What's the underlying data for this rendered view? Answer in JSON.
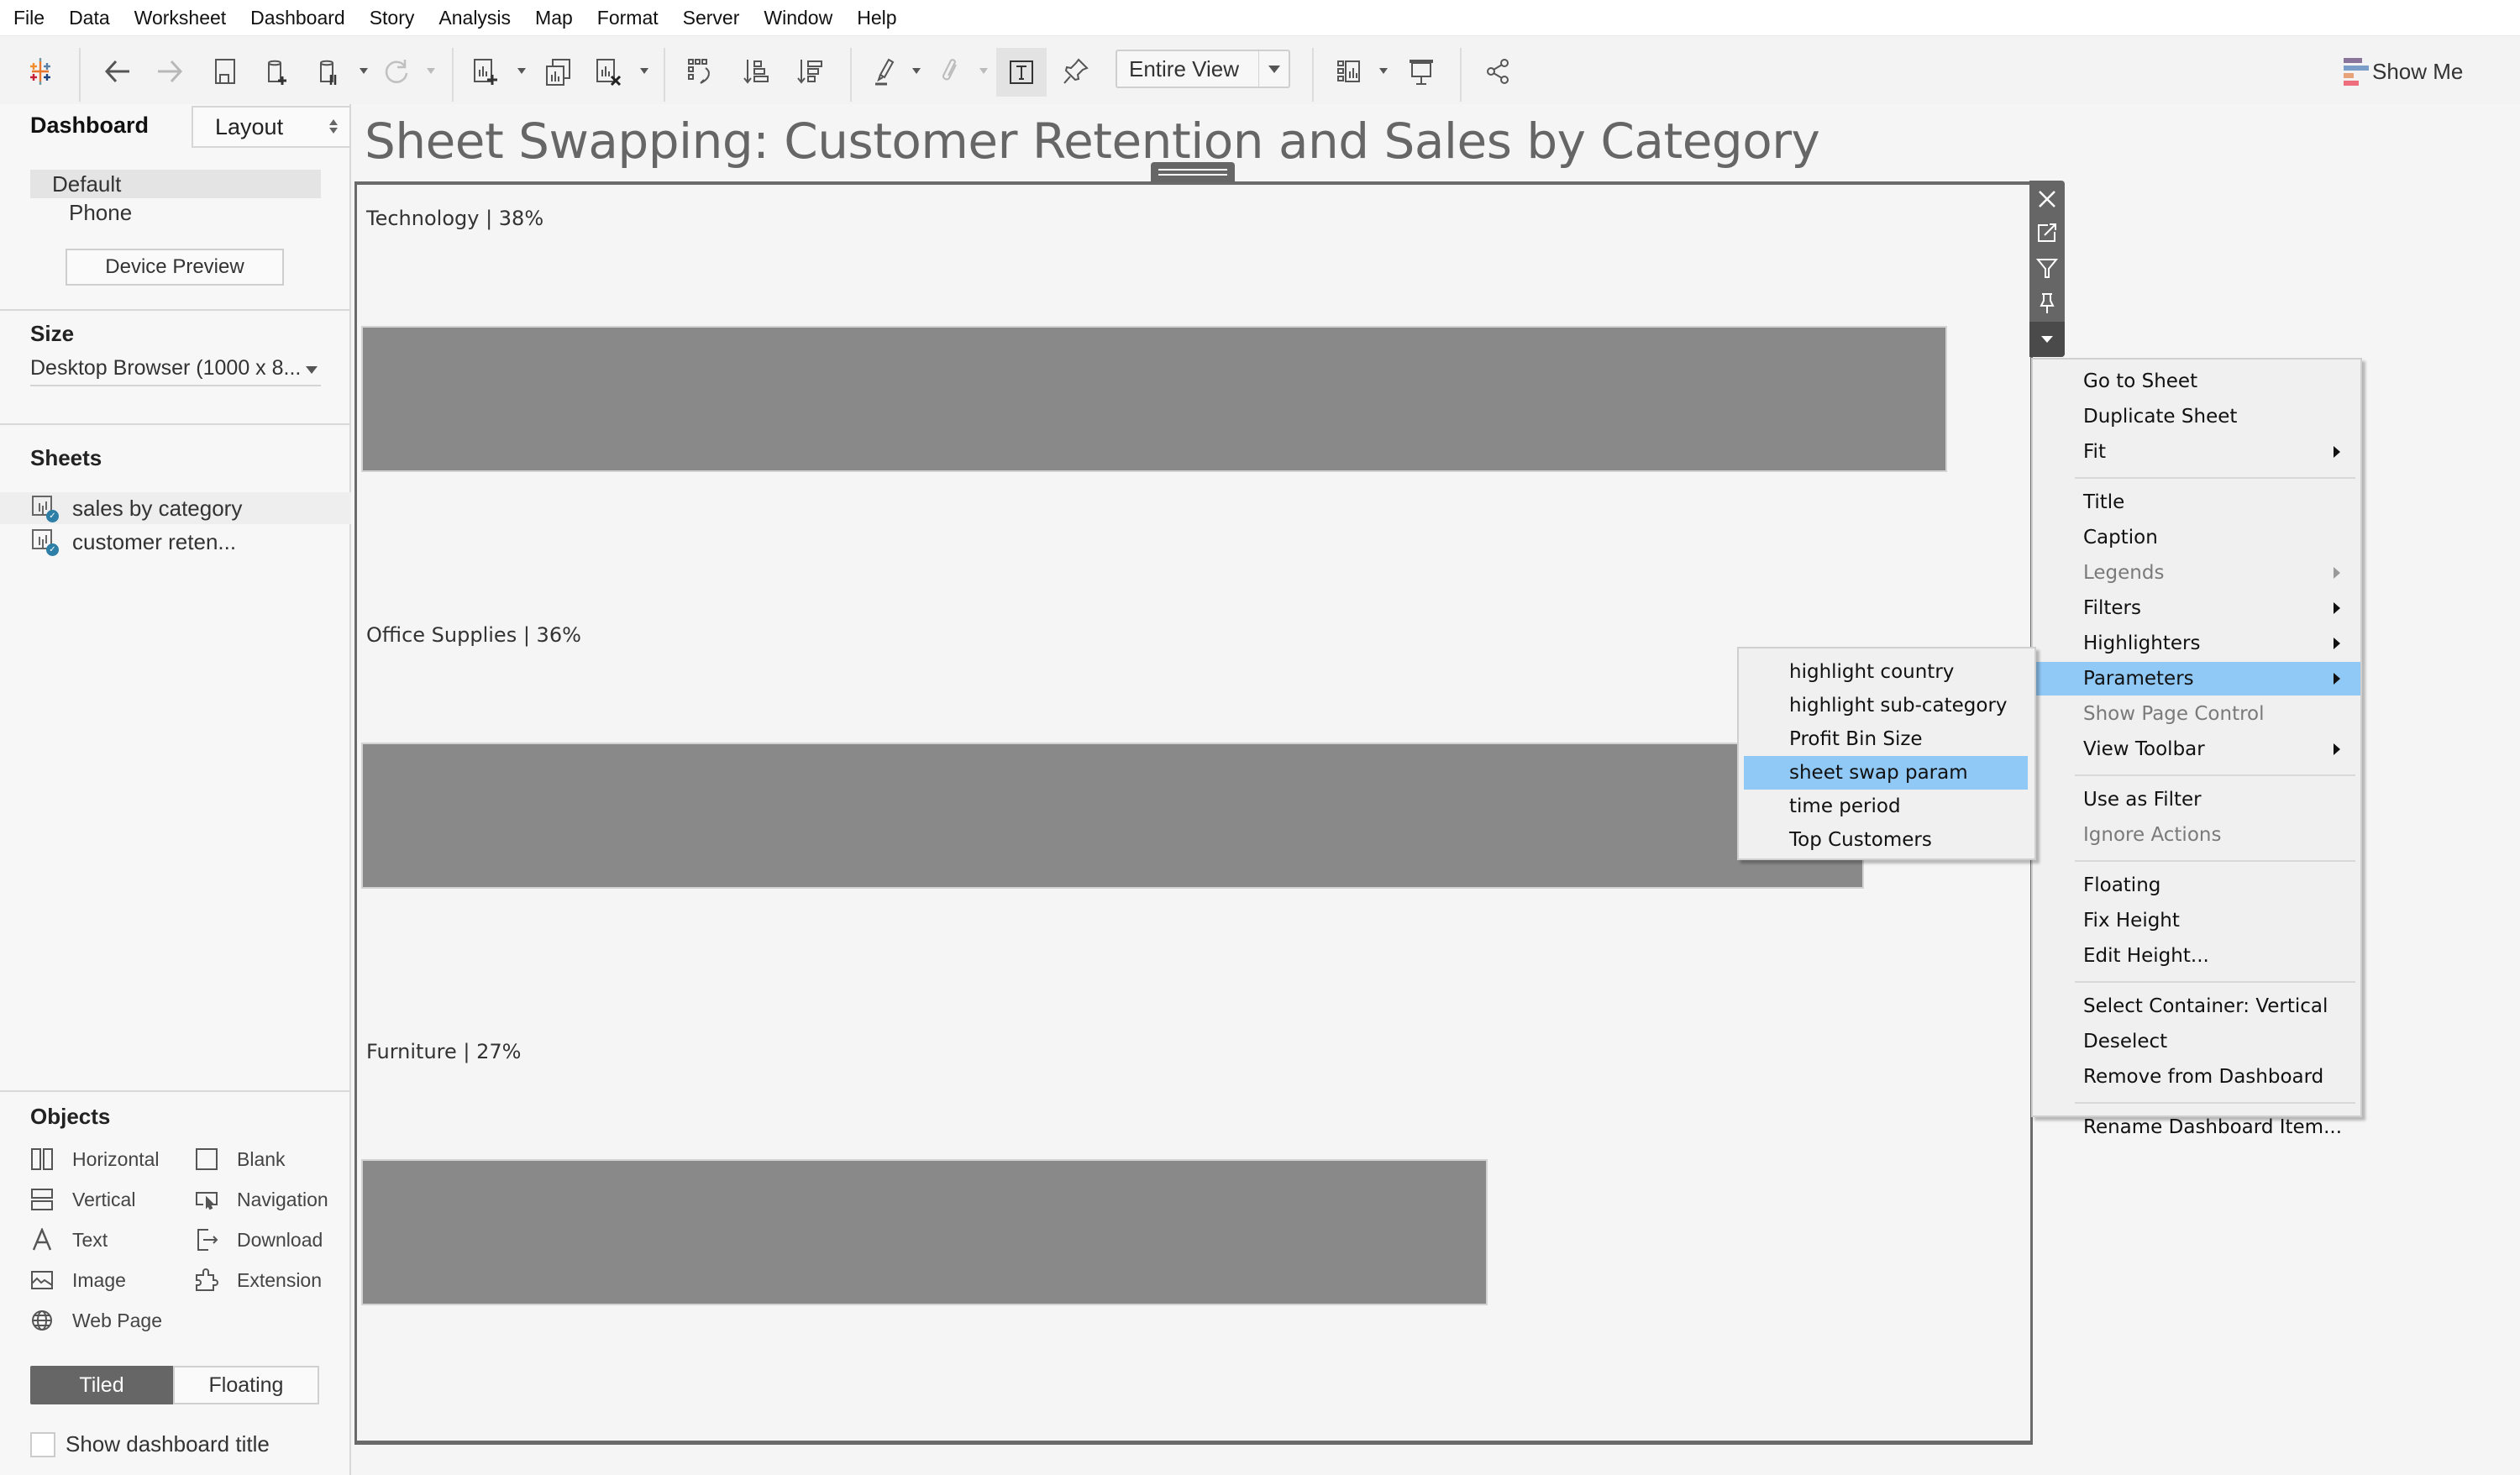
{
  "menubar": [
    "File",
    "Data",
    "Worksheet",
    "Dashboard",
    "Story",
    "Analysis",
    "Map",
    "Format",
    "Server",
    "Window",
    "Help"
  ],
  "toolbar": {
    "fit_select": "Entire View",
    "show_me_label": "Show Me",
    "show_me_colors": [
      "#8a7499",
      "#7b9ec9",
      "#e8a27a",
      "#ef6e7d"
    ],
    "icons": [
      "tableau-logo-icon",
      "undo-icon",
      "redo-icon",
      "save-icon",
      "new-data-source-icon",
      "pause-auto-updates-icon",
      "refresh-icon",
      "new-worksheet-icon",
      "duplicate-sheet-icon",
      "clear-sheet-icon",
      "swap-rows-columns-icon",
      "sort-ascending-icon",
      "sort-descending-icon",
      "highlight-icon",
      "group-members-icon",
      "show-mark-labels-icon",
      "fix-axes-icon",
      "show-cards-icon",
      "presentation-mode-icon",
      "share-icon"
    ]
  },
  "left_panel": {
    "tabs": {
      "dashboard": "Dashboard",
      "layout": "Layout"
    },
    "devices": {
      "default": "Default",
      "phone": "Phone",
      "preview_button": "Device Preview"
    },
    "size": {
      "heading": "Size",
      "value": "Desktop Browser (1000 x 8..."
    },
    "sheets": {
      "heading": "Sheets",
      "items": [
        {
          "label": "sales by category",
          "used": true
        },
        {
          "label": "customer reten...",
          "used": true
        }
      ]
    },
    "objects": {
      "heading": "Objects",
      "items": [
        {
          "label": "Horizontal",
          "icon": "horizontal-container-icon"
        },
        {
          "label": "Blank",
          "icon": "blank-icon"
        },
        {
          "label": "Vertical",
          "icon": "vertical-container-icon"
        },
        {
          "label": "Navigation",
          "icon": "navigation-icon"
        },
        {
          "label": "Text",
          "icon": "text-icon"
        },
        {
          "label": "Download",
          "icon": "download-icon"
        },
        {
          "label": "Image",
          "icon": "image-icon"
        },
        {
          "label": "Extension",
          "icon": "extension-icon"
        },
        {
          "label": "Web Page",
          "icon": "web-page-icon"
        }
      ]
    },
    "layout_mode": {
      "tiled": "Tiled",
      "floating": "Floating",
      "selected": "Tiled"
    },
    "show_title": {
      "label": "Show dashboard title",
      "checked": false
    }
  },
  "dashboard": {
    "title": "Sheet Swapping: Customer Retention and Sales by Category"
  },
  "chart_data": {
    "type": "bar",
    "orientation": "horizontal",
    "title": "",
    "categories": [
      "Technology",
      "Office Supplies",
      "Furniture"
    ],
    "labels": [
      "Technology | 38%",
      "Office Supplies | 36%",
      "Furniture | 27%"
    ],
    "values": [
      38,
      36,
      27
    ],
    "unit": "%",
    "bar_color": "#898989",
    "xlabel": "",
    "ylabel": "",
    "grid": false
  },
  "item_toolbar": [
    "close-icon",
    "go-to-sheet-icon",
    "filter-icon",
    "pin-icon",
    "more-options-icon"
  ],
  "context_menu": {
    "groups": [
      [
        {
          "label": "Go to Sheet",
          "enabled": true,
          "submenu": false
        },
        {
          "label": "Duplicate Sheet",
          "enabled": true,
          "submenu": false
        },
        {
          "label": "Fit",
          "enabled": true,
          "submenu": true
        }
      ],
      [
        {
          "label": "Title",
          "enabled": true,
          "submenu": false
        },
        {
          "label": "Caption",
          "enabled": true,
          "submenu": false
        },
        {
          "label": "Legends",
          "enabled": false,
          "submenu": true
        },
        {
          "label": "Filters",
          "enabled": true,
          "submenu": true
        },
        {
          "label": "Highlighters",
          "enabled": true,
          "submenu": true
        },
        {
          "label": "Parameters",
          "enabled": true,
          "submenu": true,
          "highlighted": true
        },
        {
          "label": "Show Page Control",
          "enabled": false,
          "submenu": false
        },
        {
          "label": "View Toolbar",
          "enabled": true,
          "submenu": true
        }
      ],
      [
        {
          "label": "Use as Filter",
          "enabled": true,
          "submenu": false
        },
        {
          "label": "Ignore Actions",
          "enabled": false,
          "submenu": false
        }
      ],
      [
        {
          "label": "Floating",
          "enabled": true,
          "submenu": false
        },
        {
          "label": "Fix Height",
          "enabled": true,
          "submenu": false
        },
        {
          "label": "Edit Height...",
          "enabled": true,
          "submenu": false
        }
      ],
      [
        {
          "label": "Select Container: Vertical",
          "enabled": true,
          "submenu": false
        },
        {
          "label": "Deselect",
          "enabled": true,
          "submenu": false
        },
        {
          "label": "Remove from Dashboard",
          "enabled": true,
          "submenu": false
        }
      ],
      [
        {
          "label": "Rename Dashboard Item...",
          "enabled": true,
          "submenu": false
        }
      ]
    ]
  },
  "parameters_submenu": {
    "items": [
      "highlight country",
      "highlight sub-category",
      "Profit Bin Size",
      "sheet swap param",
      "time period",
      "Top Customers"
    ],
    "highlighted": "sheet swap param"
  },
  "colors": {
    "highlight": "#90c8f6",
    "frame": "#6a6a6a",
    "check_badge": "#2d7fa8"
  }
}
